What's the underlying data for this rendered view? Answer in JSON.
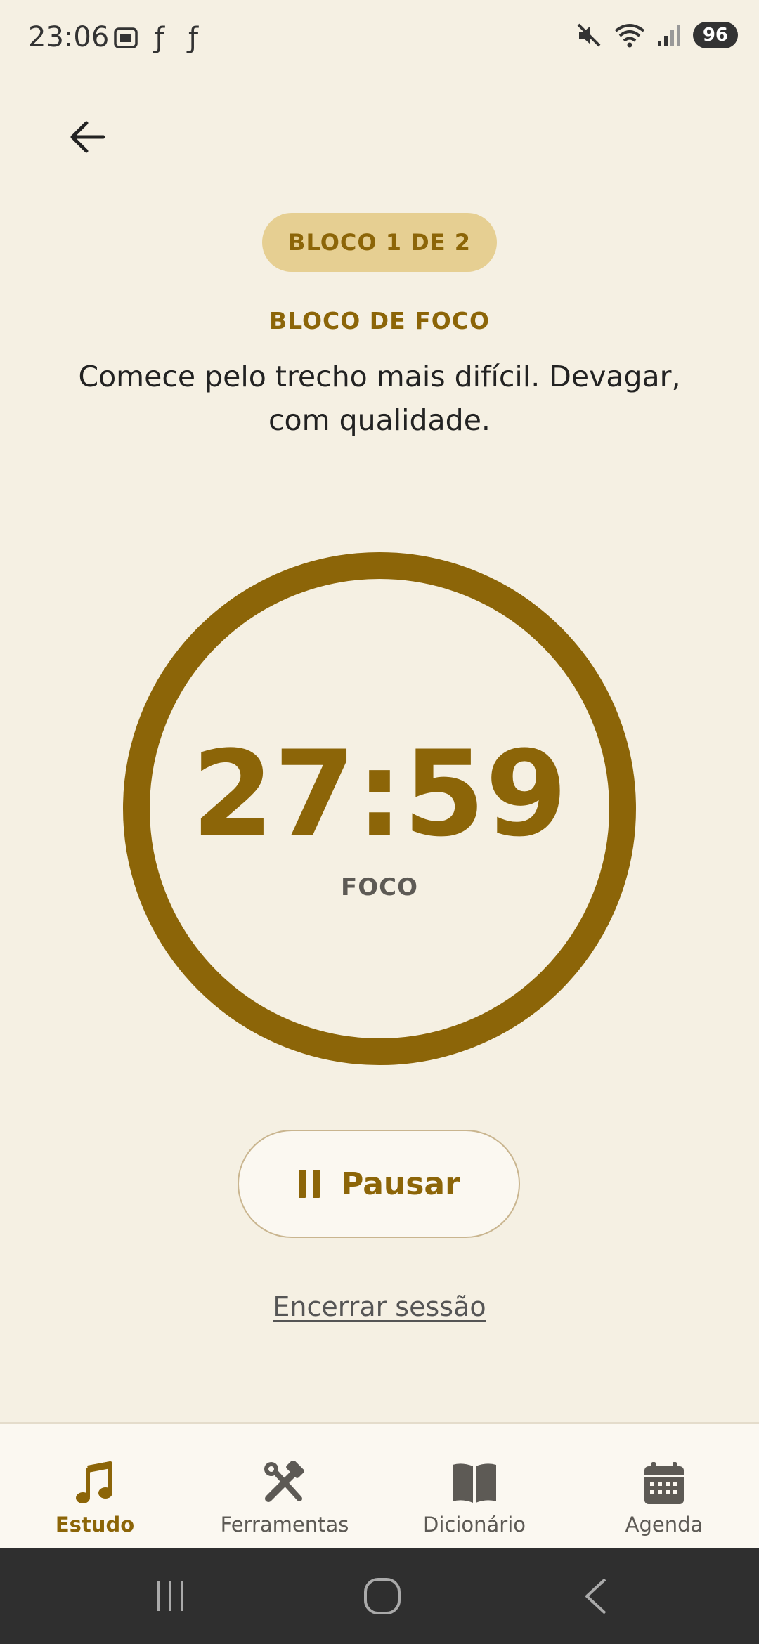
{
  "status_bar": {
    "time": "23:06",
    "battery": "96",
    "left_icons": [
      "screenshot-icon",
      "app-f-icon",
      "app-f-icon"
    ],
    "right_icons": [
      "mute-icon",
      "wifi-icon",
      "signal-icon"
    ]
  },
  "header": {
    "back_icon": "arrow-left-icon"
  },
  "session": {
    "block_badge": "BLOCO 1 DE 2",
    "block_title": "BLOCO DE FOCO",
    "block_description": "Comece pelo trecho mais difícil. Devagar, com qualidade."
  },
  "timer": {
    "value": "27:59",
    "label": "FOCO",
    "ring_progress": 1.0,
    "ring_color": "#8c6508"
  },
  "controls": {
    "pause_label": "Pausar",
    "pause_icon": "pause-icon",
    "end_session_label": "Encerrar sessão"
  },
  "bottom_nav": {
    "items": [
      {
        "label": "Estudo",
        "icon": "music-note-icon",
        "active": true
      },
      {
        "label": "Ferramentas",
        "icon": "tools-icon",
        "active": false
      },
      {
        "label": "Dicionário",
        "icon": "book-icon",
        "active": false
      },
      {
        "label": "Agenda",
        "icon": "calendar-icon",
        "active": false
      }
    ]
  },
  "colors": {
    "accent": "#8c6508",
    "background": "#f5f0e3",
    "pill": "#e6cf92"
  }
}
